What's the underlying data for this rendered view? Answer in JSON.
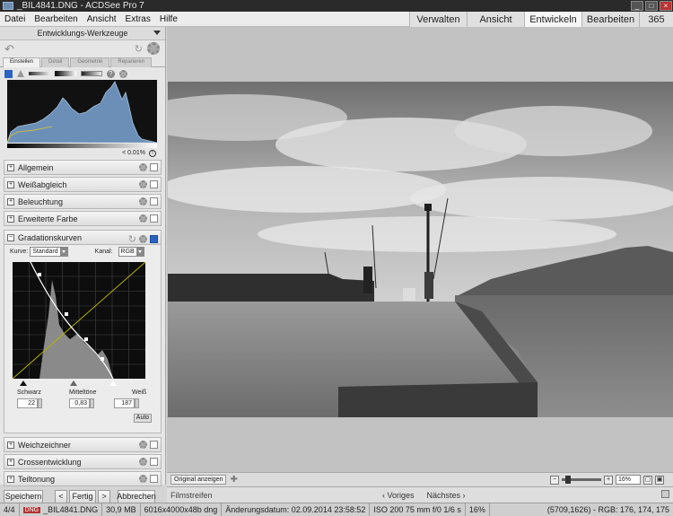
{
  "window": {
    "title": "_BIL4841.DNG - ACDSee Pro 7"
  },
  "menu": {
    "items": [
      "Datei",
      "Bearbeiten",
      "Ansicht",
      "Extras",
      "Hilfe"
    ]
  },
  "modes": {
    "tabs": [
      "Verwalten",
      "Ansicht",
      "Entwickeln",
      "Bearbeiten",
      "365"
    ],
    "active": "Entwickeln"
  },
  "left_panel": {
    "header": "Entwicklungs-Werkzeuge",
    "tabs": [
      "Einstellen",
      "Detail",
      "Geometrie",
      "Reparieren"
    ],
    "active_tab": "Einstellen",
    "clip_warning": "< 0.01%",
    "sections_top": [
      "Allgemein",
      "Weißabgleich",
      "Beleuchtung",
      "Erweiterte Farbe"
    ],
    "curves": {
      "title": "Gradationskurven",
      "kurve_label": "Kurve:",
      "kurve_value": "Standard",
      "kanal_label": "Kanal:",
      "kanal_value": "RGB",
      "schwarz_label": "Schwarz",
      "mitteltoene_label": "Mitteltöne",
      "weiss_label": "Weiß",
      "schwarz_value": "22",
      "mitteltoene_value": "0,83",
      "weiss_value": "187",
      "auto_label": "Auto"
    },
    "sections_bottom": [
      "Weichzeichner",
      "Crossentwicklung",
      "Teiltonung"
    ]
  },
  "buttons": {
    "save": "Speichern",
    "prev": "<",
    "done": "Fertig",
    "next": ">",
    "cancel": "Abbrechen"
  },
  "image_toolbar": {
    "original_btn": "Original anzeigen",
    "zoom": "16%"
  },
  "filmstrip": {
    "title": "Filmstreifen",
    "prev": "‹ Voriges",
    "next": "Nächstes ›"
  },
  "status": {
    "index": "4/4",
    "badge": "DNG",
    "filename": "_BIL4841.DNG",
    "size": "30,9 MB",
    "dimensions": "6016x4000x48b dng",
    "modified": "Änderungsdatum: 02.09.2014 23:58:52",
    "exif": "ISO 200   75 mm   f/0   1/6 s",
    "zoom": "16%",
    "pixel": "(5709,1626) - RGB: 176, 174, 175"
  },
  "colors": {
    "accent": "#2a63c4",
    "title_bar": "#2a2a2a",
    "histogram_fill": "#6b8fb7"
  }
}
